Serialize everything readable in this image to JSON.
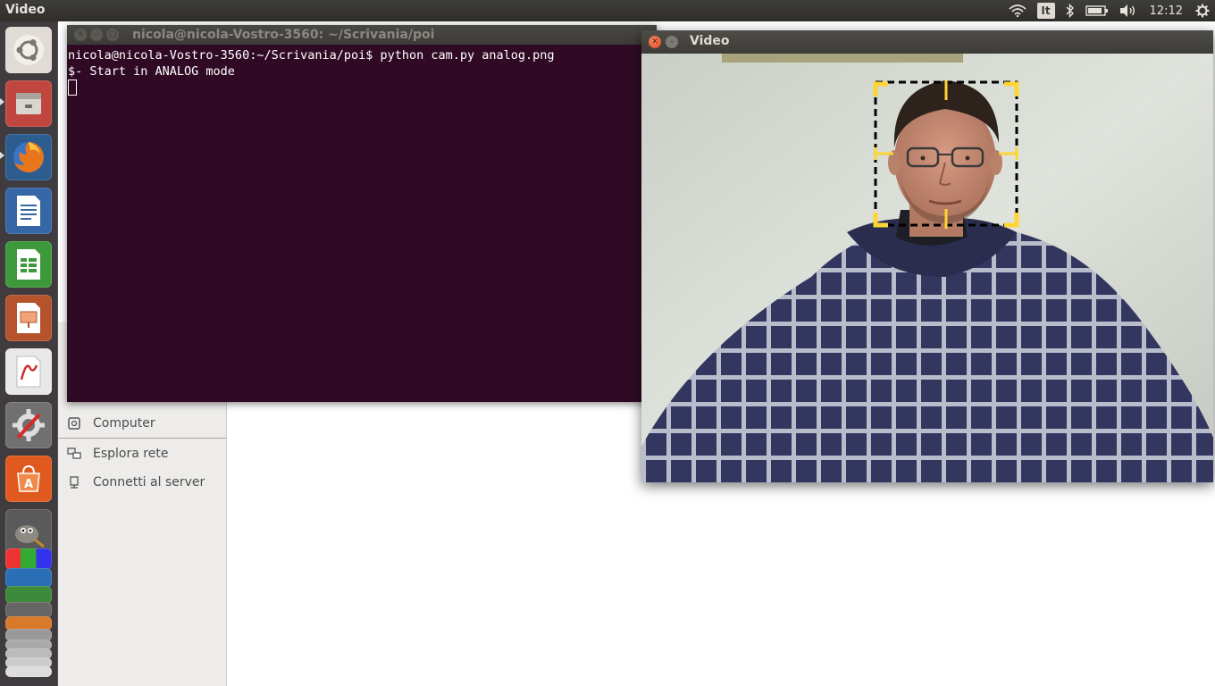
{
  "top_panel": {
    "app_title": "Video",
    "keyboard_layout": "It",
    "clock": "12:12",
    "icons": [
      "wifi-icon",
      "bluetooth-icon",
      "battery-icon",
      "volume-icon",
      "settings-gear-icon"
    ]
  },
  "launcher": {
    "items": [
      {
        "name": "ubuntu-dash",
        "color": "#d9d4ce"
      },
      {
        "name": "files",
        "color": "#c7443a"
      },
      {
        "name": "firefox",
        "color": "#e8761d"
      },
      {
        "name": "libreoffice-writer",
        "color": "#3d6fb4"
      },
      {
        "name": "libreoffice-calc",
        "color": "#3d9a3a"
      },
      {
        "name": "libreoffice-impress",
        "color": "#b5542c"
      },
      {
        "name": "document-viewer",
        "color": "#cc2d2d"
      },
      {
        "name": "system-settings",
        "color": "#8a8a8a"
      },
      {
        "name": "software-center",
        "color": "#e05a1f"
      },
      {
        "name": "gimp",
        "color": "#6b6b6b"
      }
    ]
  },
  "files_sidebar": {
    "computer": "Computer",
    "network": "Esplora rete",
    "connect": "Connetti al server"
  },
  "terminal": {
    "title": "nicola@nicola-Vostro-3560: ~/Scrivania/poi",
    "line1": "nicola@nicola-Vostro-3560:~/Scrivania/poi$ python cam.py analog.png",
    "line2": "$- Start in ANALOG mode"
  },
  "video": {
    "title": "Video"
  },
  "colors": {
    "terminal_bg": "#300a24",
    "panel_bg": "#3c3b37",
    "launcher_bg": "#3f3b3e",
    "overlay_yellow": "#ffd535"
  }
}
